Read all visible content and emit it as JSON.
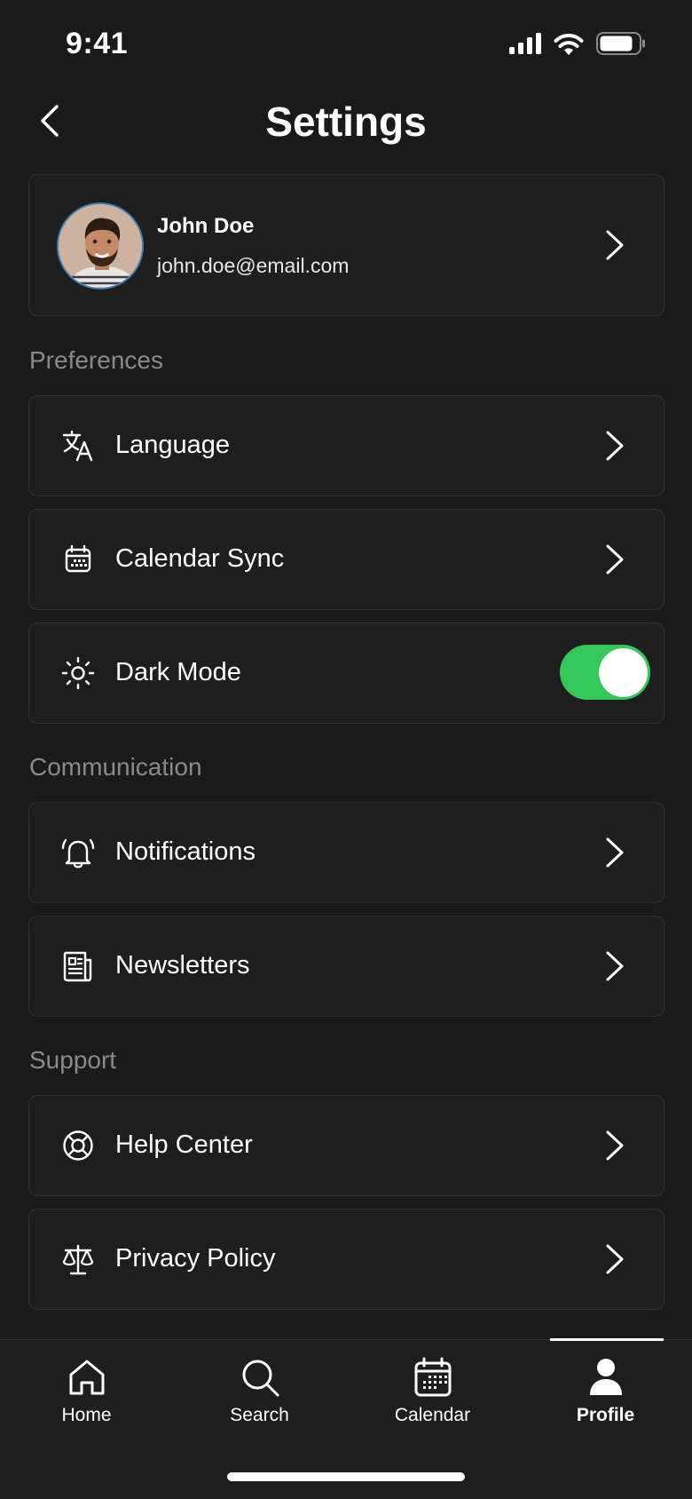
{
  "status_bar": {
    "time": "9:41"
  },
  "header": {
    "title": "Settings"
  },
  "profile": {
    "name": "John Doe",
    "email": "john.doe@email.com"
  },
  "sections": {
    "preferences": {
      "title": "Preferences",
      "items": [
        {
          "label": "Language",
          "icon": "translate-icon"
        },
        {
          "label": "Calendar Sync",
          "icon": "calendar-icon"
        },
        {
          "label": "Dark Mode",
          "icon": "sun-icon",
          "toggle": true
        }
      ]
    },
    "communication": {
      "title": "Communication",
      "items": [
        {
          "label": "Notifications",
          "icon": "bell-icon"
        },
        {
          "label": "Newsletters",
          "icon": "newspaper-icon"
        }
      ]
    },
    "support": {
      "title": "Support",
      "items": [
        {
          "label": "Help Center",
          "icon": "lifebuoy-icon"
        },
        {
          "label": "Privacy Policy",
          "icon": "scale-icon"
        }
      ]
    }
  },
  "tabs": [
    {
      "label": "Home",
      "icon": "home-icon"
    },
    {
      "label": "Search",
      "icon": "search-icon"
    },
    {
      "label": "Calendar",
      "icon": "calendar-icon"
    },
    {
      "label": "Profile",
      "icon": "person-icon",
      "active": true
    }
  ],
  "colors": {
    "background": "#1a1a1a",
    "card": "#1e1e1e",
    "toggle_on": "#34c759",
    "section_title": "#8a8a8a"
  }
}
